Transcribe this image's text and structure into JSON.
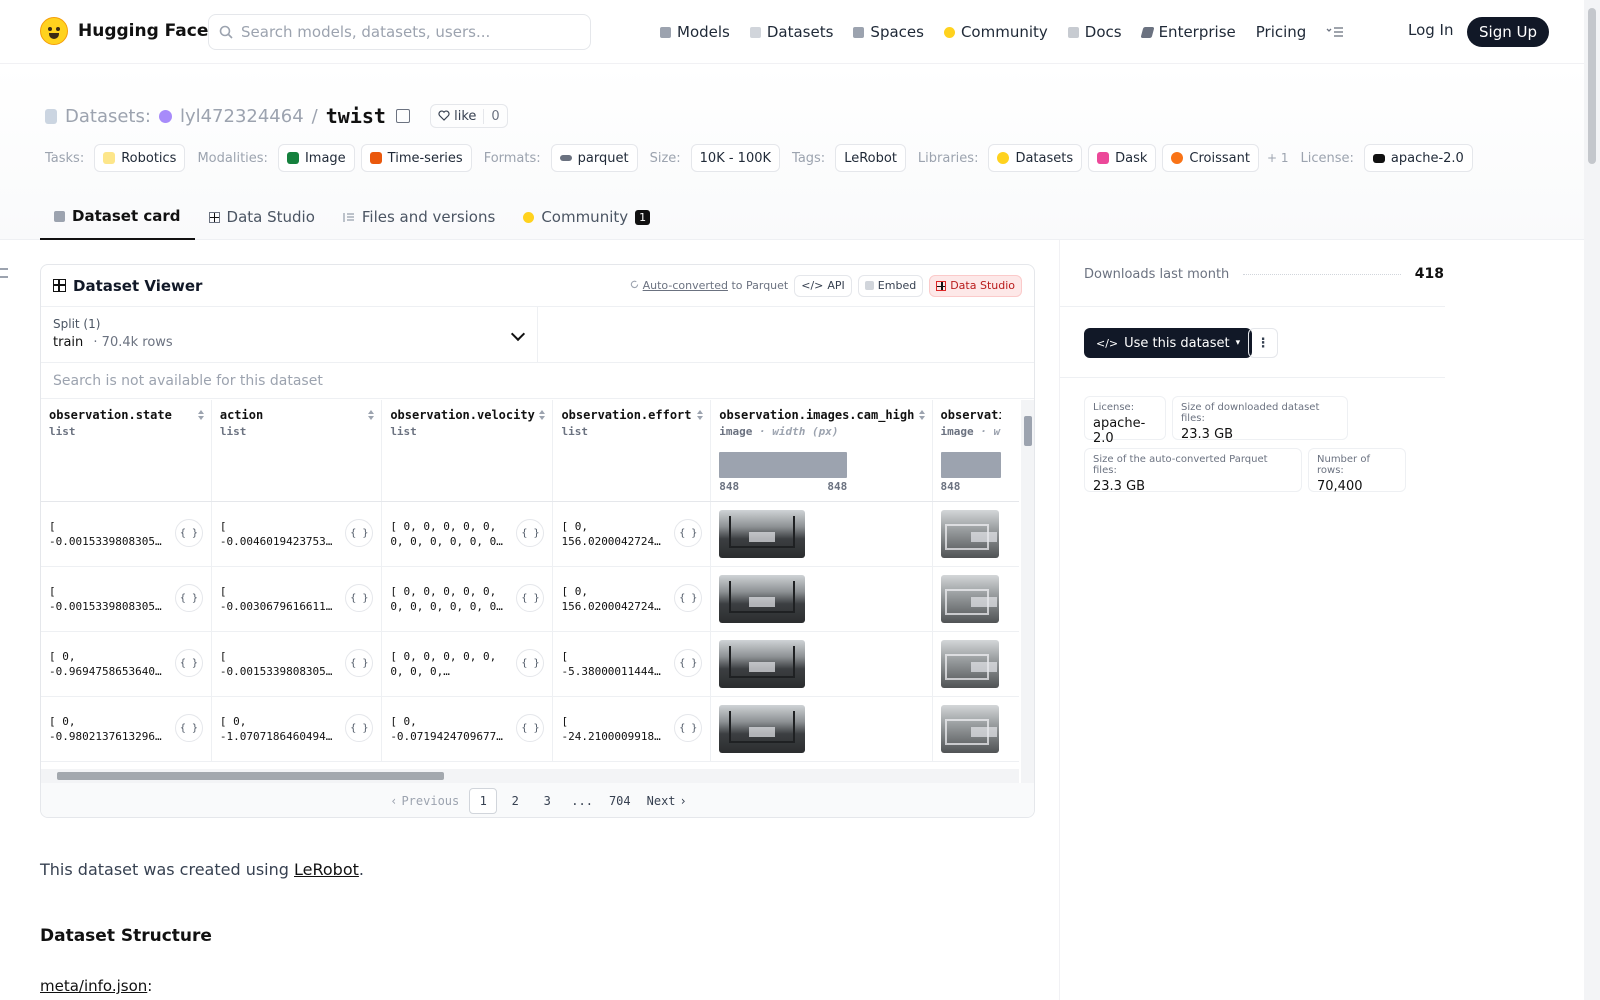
{
  "header": {
    "brand": "Hugging Face",
    "search_placeholder": "Search models, datasets, users...",
    "nav": [
      {
        "label": "Models",
        "icon": "cube-icon",
        "color": "#9ca3af"
      },
      {
        "label": "Datasets",
        "icon": "database-icon",
        "color": "#d1d5db"
      },
      {
        "label": "Spaces",
        "icon": "spaces-icon",
        "color": "#9ca3af"
      },
      {
        "label": "Community",
        "icon": "hf-community-icon",
        "color": "#FFD21E"
      },
      {
        "label": "Docs",
        "icon": "book-icon",
        "color": "#c7cbd1"
      },
      {
        "label": "Enterprise",
        "icon": "enterprise-icon",
        "color": "#6b7280"
      },
      {
        "label": "Pricing",
        "icon": "",
        "color": ""
      }
    ],
    "login": "Log In",
    "signup": "Sign Up"
  },
  "repo": {
    "section": "Datasets:",
    "owner": "lyl472324464",
    "separator": "/",
    "name": "twist",
    "like_label": "like",
    "like_count": "0"
  },
  "tags": {
    "tasks_label": "Tasks:",
    "tasks": [
      "Robotics"
    ],
    "modalities_label": "Modalities:",
    "modalities": [
      "Image",
      "Time-series"
    ],
    "formats_label": "Formats:",
    "formats": [
      "parquet"
    ],
    "size_label": "Size:",
    "size": "10K - 100K",
    "tags_label": "Tags:",
    "tags": [
      "LeRobot"
    ],
    "libraries_label": "Libraries:",
    "libraries": [
      "Datasets",
      "Dask",
      "Croissant"
    ],
    "libraries_more": "+ 1",
    "license_label": "License:",
    "license": "apache-2.0"
  },
  "tabs": [
    {
      "label": "Dataset card",
      "active": true
    },
    {
      "label": "Data Studio"
    },
    {
      "label": "Files and versions"
    },
    {
      "label": "Community",
      "badge": "1"
    }
  ],
  "viewer": {
    "title": "Dataset Viewer",
    "auto_converted": "Auto-converted",
    "to_parquet": "to Parquet",
    "api": "API",
    "embed": "Embed",
    "data_studio": "Data Studio",
    "split_label": "Split (1)",
    "split_name": "train",
    "split_rows": "70.4k rows",
    "search_disabled": "Search is not available for this dataset",
    "columns": [
      {
        "name": "observation.state",
        "type": "list"
      },
      {
        "name": "action",
        "type": "list"
      },
      {
        "name": "observation.velocity",
        "type": "list"
      },
      {
        "name": "observation.effort",
        "type": "list"
      },
      {
        "name": "observation.images.cam_high",
        "type": "image",
        "sub": "· width (px)",
        "min": "848",
        "max": "848"
      },
      {
        "name": "observation.images.cam_left_wrist",
        "type": "image",
        "sub": "· w",
        "min": "848",
        "max": ""
      }
    ],
    "rows": [
      [
        "[\n-0.0015339808305…",
        "[\n-0.0046019423753…",
        "[ 0, 0, 0, 0, 0,\n0, 0, 0, 0, 0, 0…",
        "[ 0,\n156.0200042724…"
      ],
      [
        "[\n-0.0015339808305…",
        "[\n-0.0030679616611…",
        "[ 0, 0, 0, 0, 0,\n0, 0, 0, 0, 0, 0…",
        "[ 0,\n156.0200042724…"
      ],
      [
        "[ 0,\n-0.9694758653640…",
        "[\n-0.0015339808305…",
        "[ 0, 0, 0, 0, 0,\n0, 0, 0,…",
        "[\n-5.38000011444…"
      ],
      [
        "[ 0,\n-0.9802137613296…",
        "[ 0,\n-1.0707186460494…",
        "[ 0,\n-0.0719424709677…",
        "[\n-24.2100009918…"
      ]
    ],
    "pager": {
      "prev": "Previous",
      "pages": [
        "1",
        "2",
        "3",
        "...",
        "704"
      ],
      "current": "1",
      "next": "Next"
    }
  },
  "card": {
    "intro_prefix": "This dataset was created using ",
    "intro_link": "LeRobot",
    "intro_suffix": ".",
    "h_structure": "Dataset Structure",
    "meta_link": "meta/info.json",
    "meta_suffix": ":"
  },
  "sidebar": {
    "downloads_label": "Downloads last month",
    "downloads": "418",
    "use_button": "Use this dataset",
    "stats": [
      {
        "label": "License:",
        "value": "apache-2.0"
      },
      {
        "label": "Size of downloaded dataset files:",
        "value": "23.3 GB"
      },
      {
        "label": "Size of the auto-converted Parquet files:",
        "value": "23.3 GB"
      },
      {
        "label": "Number of rows:",
        "value": "70,400"
      }
    ]
  }
}
